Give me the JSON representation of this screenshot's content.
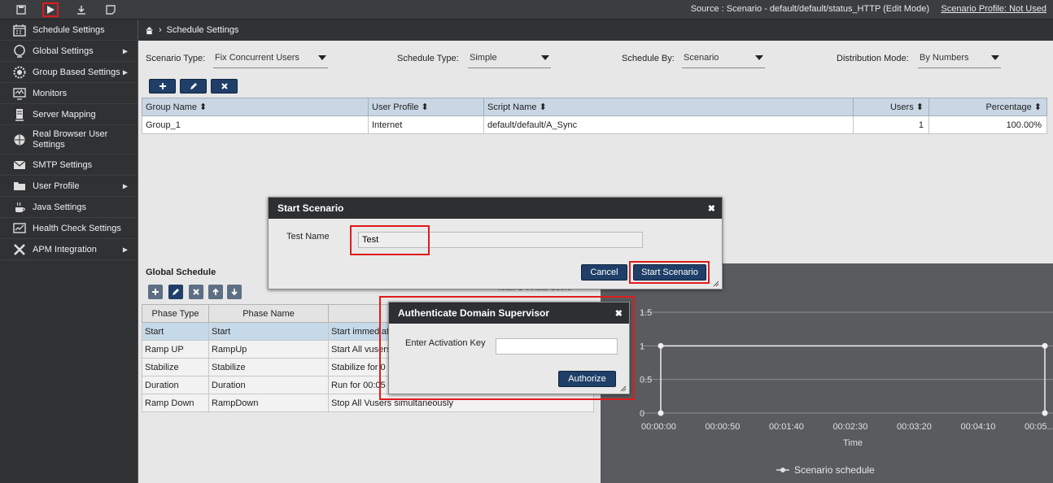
{
  "topbar": {
    "source": "Source : Scenario - default/default/status_HTTP (Edit Mode)",
    "profile": "Scenario Profile: Not Used",
    "icons": [
      "save-icon",
      "play-icon",
      "download-icon",
      "note-icon"
    ]
  },
  "sidebar": {
    "items": [
      {
        "label": "Schedule Settings",
        "icon": "calendar-icon"
      },
      {
        "label": "Global Settings",
        "icon": "globe-icon"
      },
      {
        "label": "Group Based Settings",
        "icon": "gear-group-icon"
      },
      {
        "label": "Monitors",
        "icon": "monitor-icon"
      },
      {
        "label": "Server Mapping",
        "icon": "server-icon"
      },
      {
        "label": "Real Browser User Settings",
        "icon": "browser-icon"
      },
      {
        "label": "SMTP Settings",
        "icon": "mail-icon"
      },
      {
        "label": "User Profile",
        "icon": "folder-icon"
      },
      {
        "label": "Java Settings",
        "icon": "java-icon"
      },
      {
        "label": "Health Check Settings",
        "icon": "health-chart-icon"
      },
      {
        "label": "APM Integration",
        "icon": "tools-icon"
      }
    ]
  },
  "breadcrumb": {
    "current": "Schedule Settings"
  },
  "settings": {
    "scenario_type_label": "Scenario Type:",
    "scenario_type_value": "Fix Concurrent Users",
    "schedule_type_label": "Schedule Type:",
    "schedule_type_value": "Simple",
    "schedule_by_label": "Schedule By:",
    "schedule_by_value": "Scenario",
    "distribution_label": "Distribution Mode:",
    "distribution_value": "By Numbers"
  },
  "group_table": {
    "headers": [
      "Group Name",
      "User Profile",
      "Script Name",
      "Users",
      "Percentage"
    ],
    "rows": [
      [
        "Group_1",
        "Internet",
        "default/default/A_Sync",
        "1",
        "100.00%"
      ]
    ]
  },
  "global_schedule": {
    "title": "Global Schedule",
    "total": "Total: 1 Virtual Users",
    "headers": [
      "Phase Type",
      "Phase Name",
      ""
    ],
    "rows": [
      [
        "Start",
        "Start",
        "Start immediately"
      ],
      [
        "Ramp UP",
        "RampUp",
        "Start All vusers"
      ],
      [
        "Stabilize",
        "Stabilize",
        "Stabilize for 0"
      ],
      [
        "Duration",
        "Duration",
        "Run for 00:05"
      ],
      [
        "Ramp Down",
        "RampDown",
        "Stop All Vusers simultaneously"
      ]
    ]
  },
  "chart_data": {
    "type": "line",
    "title": "",
    "xlabel": "Time",
    "ylabel": "",
    "x_ticks": [
      "00:00:00",
      "00:00:50",
      "00:01:40",
      "00:02:30",
      "00:03:20",
      "00:04:10",
      "00:05..."
    ],
    "y_ticks": [
      "0",
      "0.5",
      "1",
      "1.5"
    ],
    "ylim": [
      0,
      1.5
    ],
    "series": [
      {
        "name": "Scenario schedule",
        "x": [
          0,
          0,
          300,
          300
        ],
        "y": [
          0,
          1,
          1,
          0
        ]
      }
    ],
    "legend": "bottom",
    "grid": true,
    "colors": {
      "background": "#595b5e",
      "line": "#f0f0f0"
    }
  },
  "start_dialog": {
    "title": "Start Scenario",
    "test_name_label": "Test Name",
    "test_name_value": "Test",
    "cancel_label": "Cancel",
    "start_label": "Start Scenario"
  },
  "auth_dialog": {
    "title": "Authenticate Domain Supervisor",
    "key_label": "Enter Activation Key",
    "key_value": "",
    "authorize_label": "Authorize"
  },
  "colors": {
    "accent": "#1f3f68",
    "highlight": "#e01b1b",
    "header": "#2d2f32"
  }
}
